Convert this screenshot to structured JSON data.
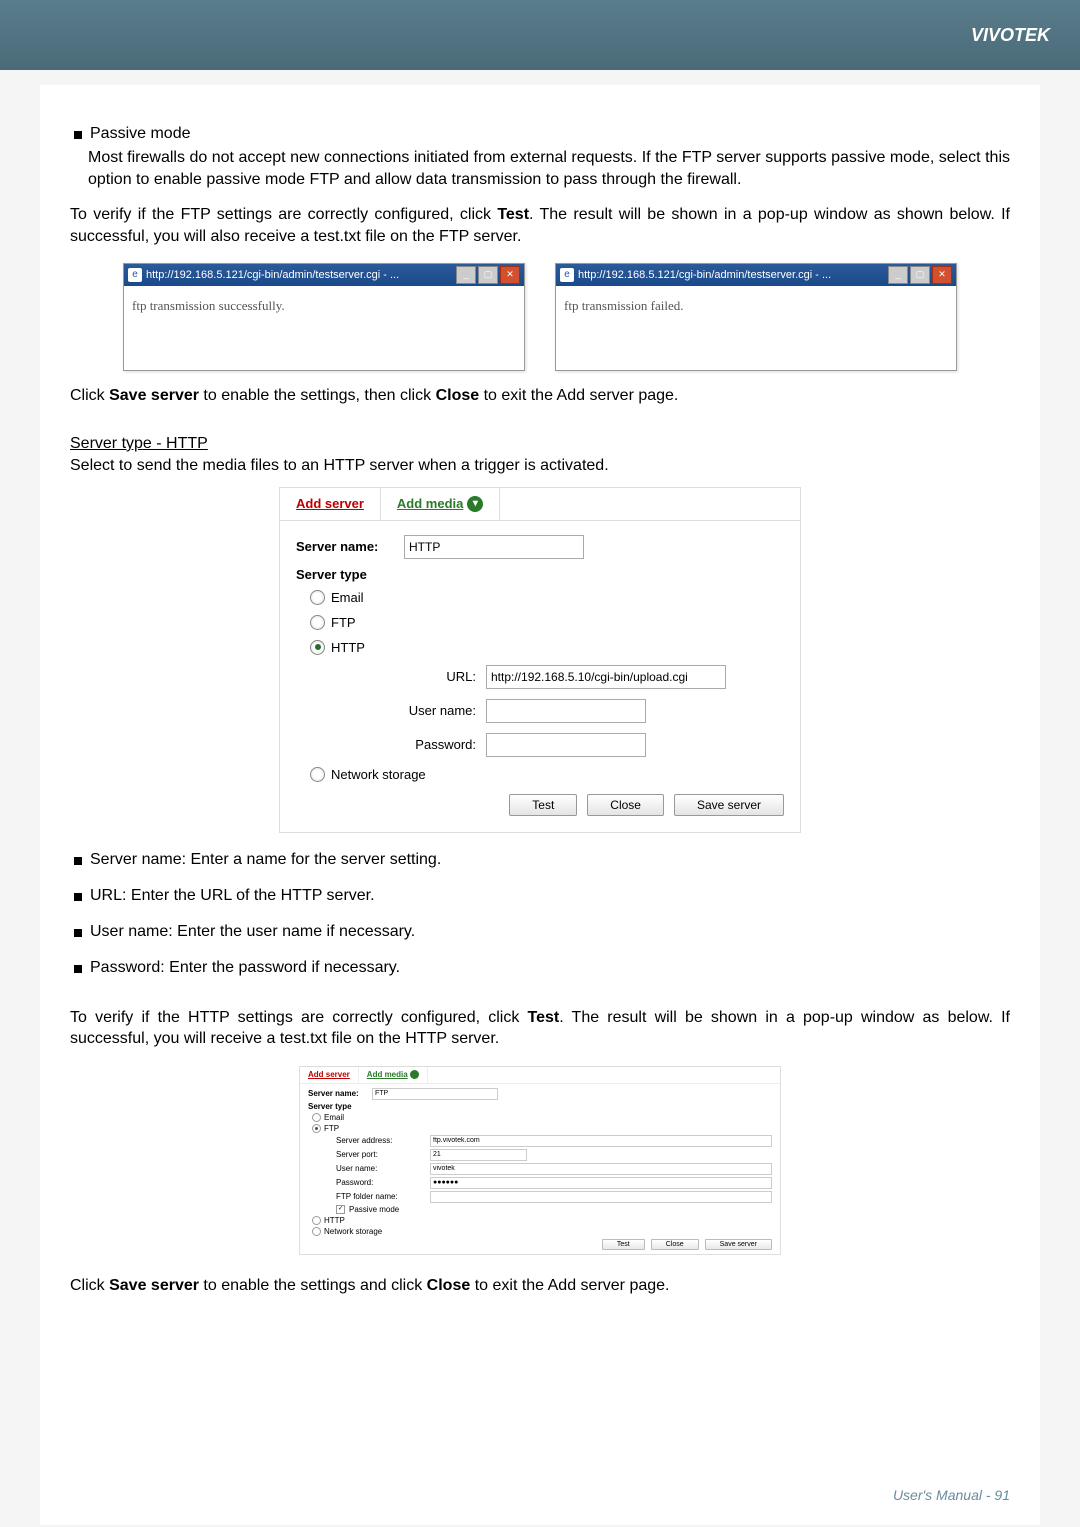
{
  "header": {
    "brand": "VIVOTEK"
  },
  "section_passive": {
    "title": "Passive mode",
    "desc": "Most firewalls do not accept new connections initiated from external requests. If the FTP server supports passive mode, select this option to enable passive mode FTP and allow data transmission to pass through the firewall."
  },
  "verify_ftp": {
    "pre": "To verify if the FTP settings are correctly configured, click ",
    "test": "Test",
    "post": ". The result will be shown in a pop-up window as shown below. If successful, you will also receive a test.txt file on the FTP server."
  },
  "popup_left": {
    "url": "http://192.168.5.121/cgi-bin/admin/testserver.cgi - ...",
    "msg": "ftp transmission successfully."
  },
  "popup_right": {
    "url": "http://192.168.5.121/cgi-bin/admin/testserver.cgi - ...",
    "msg": "ftp transmission failed."
  },
  "save_line1": {
    "pre": "Click ",
    "save": "Save server",
    "mid": " to enable the settings, then click ",
    "close": "Close",
    "post": " to exit the Add server page."
  },
  "http_heading": "Server type - HTTP",
  "http_intro": "Select to send the media files to an HTTP server when a trigger is activated.",
  "panel": {
    "tab_add_server": "Add server",
    "tab_add_media": "Add media",
    "server_name_label": "Server name:",
    "server_name_value": "HTTP",
    "server_type_label": "Server type",
    "radio_email": "Email",
    "radio_ftp": "FTP",
    "radio_http": "HTTP",
    "url_label": "URL:",
    "url_value": "http://192.168.5.10/cgi-bin/upload.cgi",
    "username_label": "User name:",
    "password_label": "Password:",
    "radio_ns": "Network storage",
    "btn_test": "Test",
    "btn_close": "Close",
    "btn_save": "Save server"
  },
  "bullets": {
    "b1": "Server name: Enter a name for the server setting.",
    "b2": "URL: Enter the URL of the HTTP server.",
    "b3": "User name: Enter the user name if necessary.",
    "b4": "Password: Enter the password if necessary."
  },
  "verify_http": {
    "pre": "To verify if the HTTP settings are correctly configured, click ",
    "test": "Test",
    "post": ". The result will be shown in a pop-up window as below. If successful, you will receive a test.txt file on the HTTP server."
  },
  "small_panel": {
    "tab_add_server": "Add server",
    "tab_add_media": "Add media",
    "server_name_label": "Server name:",
    "server_name_value": "FTP",
    "server_type_label": "Server type",
    "radio_email": "Email",
    "radio_ftp": "FTP",
    "srv_addr_label": "Server address:",
    "srv_addr_value": "ftp.vivotek.com",
    "srv_port_label": "Server port:",
    "srv_port_value": "21",
    "username_label": "User name:",
    "username_value": "vivotek",
    "password_label": "Password:",
    "password_value": "●●●●●●",
    "ftp_folder_label": "FTP folder name:",
    "passive_label": "Passive mode",
    "radio_http": "HTTP",
    "radio_ns": "Network storage",
    "btn_test": "Test",
    "btn_close": "Close",
    "btn_save": "Save server"
  },
  "save_line2": {
    "pre": "Click ",
    "save": "Save server",
    "mid": " to enable the settings and click ",
    "close": "Close",
    "post": " to exit the Add server page."
  },
  "footer": {
    "text": "User's Manual - 91"
  }
}
